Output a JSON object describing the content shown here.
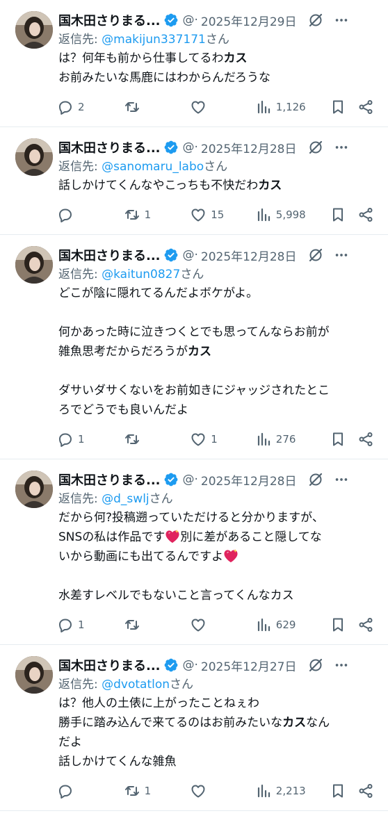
{
  "colors": {
    "accent": "#1d9bf0",
    "muted": "#536471",
    "text": "#0f1419",
    "divider": "#e6ecf0",
    "heart": "#e0245e"
  },
  "reply_prefix": "返信先: ",
  "reply_suffix": "さん",
  "tweets": [
    {
      "name": "国木田さりまる...",
      "handle": "@·",
      "date": "2025年12月29日",
      "reply_to": "@makijun337171",
      "lines": [
        [
          {
            "t": "は？何年も前から仕事してるわ"
          },
          {
            "t": "カス",
            "b": true
          }
        ],
        [
          {
            "t": "お前みたいな馬鹿にはわからんだろうな"
          }
        ]
      ],
      "replies": "2",
      "retweets": "",
      "likes": "",
      "views": "1,126"
    },
    {
      "name": "国木田さりまる...",
      "handle": "@·",
      "date": "2025年12月28日",
      "reply_to": "@sanomaru_labo",
      "lines": [
        [
          {
            "t": "話しかけてくんなやこっちも不快だわ"
          },
          {
            "t": "カス",
            "b": true
          }
        ]
      ],
      "replies": "",
      "retweets": "1",
      "likes": "15",
      "views": "5,998"
    },
    {
      "name": "国木田さりまる...",
      "handle": "@·",
      "date": "2025年12月28日",
      "reply_to": "@kaitun0827",
      "lines": [
        [
          {
            "t": "どこが陰に隠れてるんだよボケがよ。"
          }
        ],
        [
          {
            "t": ""
          }
        ],
        [
          {
            "t": "何かあった時に泣きつくとでも思ってんならお前が"
          }
        ],
        [
          {
            "t": "雑魚思考だからだろうが"
          },
          {
            "t": "カス",
            "b": true
          }
        ],
        [
          {
            "t": ""
          }
        ],
        [
          {
            "t": "ダサいダサくないをお前如きにジャッジされたとこ"
          }
        ],
        [
          {
            "t": "ろでどうでも良いんだよ"
          }
        ]
      ],
      "replies": "1",
      "retweets": "",
      "likes": "1",
      "views": "276"
    },
    {
      "name": "国木田さりまる...",
      "handle": "@·",
      "date": "2025年12月28日",
      "reply_to": "@d_swlj",
      "lines": [
        [
          {
            "t": "だから何?投稿遡っていただけると分かりますが、"
          }
        ],
        [
          {
            "t": "SNSの私は作品です"
          },
          {
            "e": "heart"
          },
          {
            "t": "別に差があること隠してな"
          }
        ],
        [
          {
            "t": "いから動画にも出てるんですよ"
          },
          {
            "e": "heart"
          }
        ],
        [
          {
            "t": ""
          }
        ],
        [
          {
            "t": "水差すレベルでもないこと言ってくんなカス"
          }
        ]
      ],
      "replies": "1",
      "retweets": "",
      "likes": "",
      "views": "629"
    },
    {
      "name": "国木田さりまる...",
      "handle": "@·",
      "date": "2025年12月27日",
      "reply_to": "@dvotatlon",
      "lines": [
        [
          {
            "t": "は？他人の土俵に上がったことねぇわ"
          }
        ],
        [
          {
            "t": "勝手に踏み込んで来てるのはお前みたいな"
          },
          {
            "t": "カス",
            "b": true
          },
          {
            "t": "なん"
          }
        ],
        [
          {
            "t": "だよ"
          }
        ],
        [
          {
            "t": "話しかけてくんな雑魚"
          }
        ]
      ],
      "replies": "",
      "retweets": "1",
      "likes": "",
      "views": "2,213"
    }
  ]
}
